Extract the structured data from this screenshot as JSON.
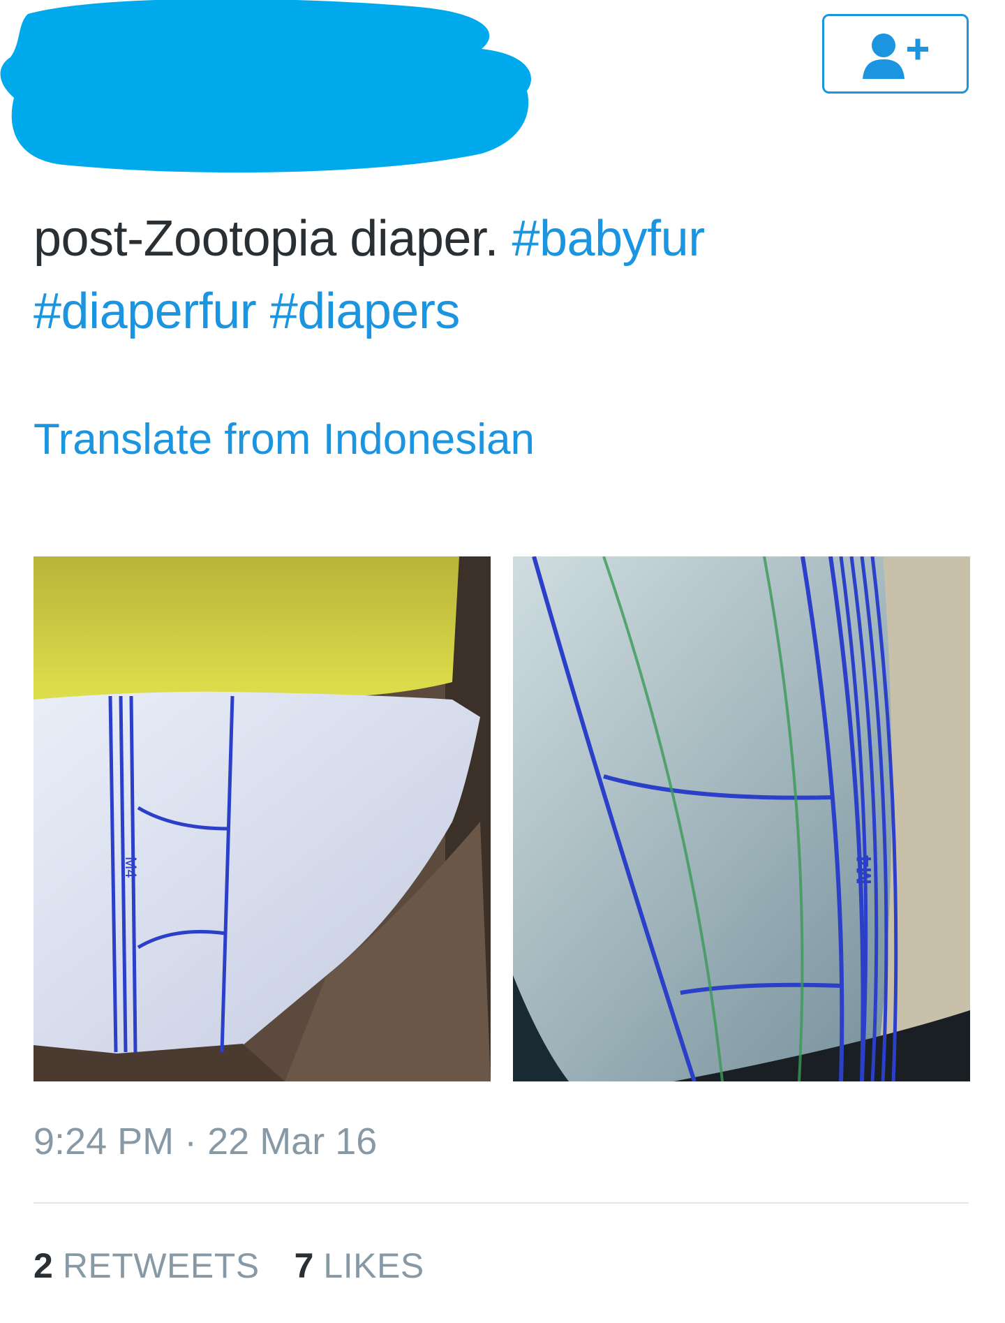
{
  "colors": {
    "link": "#1b95e0",
    "text": "#292f33",
    "muted": "#8899a6",
    "redaction": "#00a9ec"
  },
  "header": {
    "follow_button_icon": "add-user-icon"
  },
  "tweet": {
    "text": "post-Zootopia diaper.",
    "hashtags": [
      "#babyfur",
      "#diaperfur",
      "#diapers"
    ],
    "translate_label": "Translate from Indonesian",
    "time": "9:24 PM",
    "separator": "·",
    "date": "22 Mar 16"
  },
  "media": {
    "count": 2,
    "photo_1_marking": "M4",
    "photo_2_marking": "M4"
  },
  "stats": {
    "retweets_count": "2",
    "retweets_label": "RETWEETS",
    "likes_count": "7",
    "likes_label": "LIKES"
  }
}
